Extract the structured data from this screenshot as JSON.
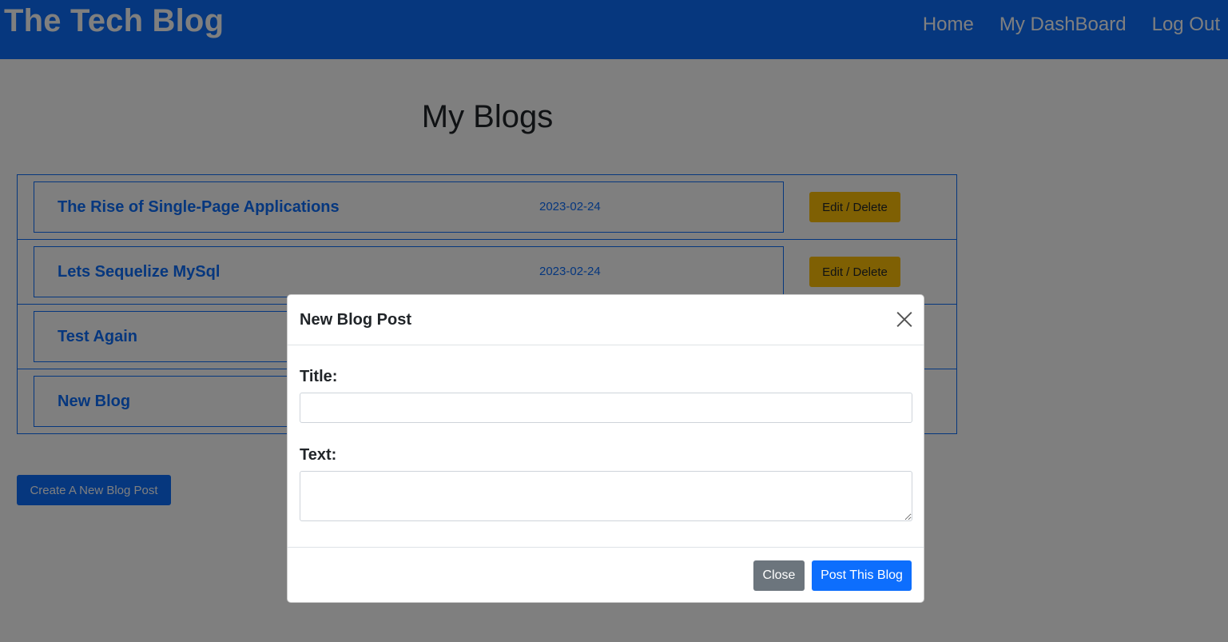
{
  "header": {
    "brand": "The Tech Blog",
    "nav": [
      "Home",
      "My DashBoard",
      "Log Out"
    ]
  },
  "main": {
    "title": "My Blogs",
    "blogs": [
      {
        "title": "The Rise of Single-Page Applications",
        "date": "2023-02-24",
        "action": "Edit / Delete"
      },
      {
        "title": "Lets Sequelize MySql",
        "date": "2023-02-24",
        "action": "Edit / Delete"
      },
      {
        "title": "Test Again",
        "date": "",
        "action": ""
      },
      {
        "title": "New Blog",
        "date": "",
        "action": ""
      }
    ],
    "create_button": "Create A New Blog Post"
  },
  "modal": {
    "title": "New Blog Post",
    "title_label": "Title:",
    "title_value": "",
    "text_label": "Text:",
    "text_value": "",
    "close_button": "Close",
    "post_button": "Post This Blog"
  },
  "colors": {
    "primary": "#0d6efd",
    "warning": "#ffc107",
    "secondary": "#6c757d"
  }
}
